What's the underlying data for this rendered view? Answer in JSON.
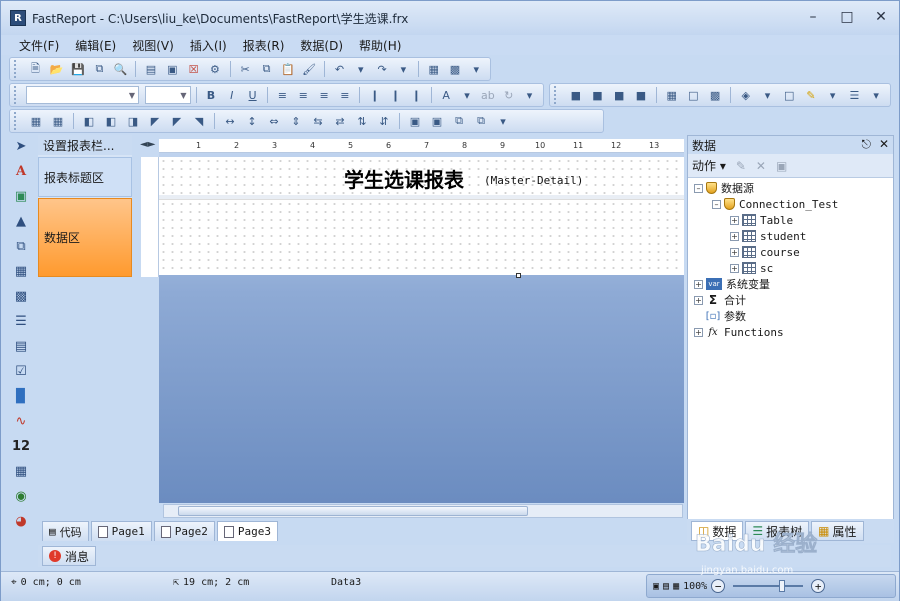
{
  "window": {
    "title": "FastReport - C:\\Users\\liu_ke\\Documents\\FastReport\\学生选课.frx",
    "icon_letter": "R"
  },
  "menu": [
    "文件(F)",
    "编辑(E)",
    "视图(V)",
    "插入(I)",
    "报表(R)",
    "数据(D)",
    "帮助(H)"
  ],
  "bands": {
    "header": "设置报表栏...",
    "title_band": "报表标题区",
    "data_band": "数据区"
  },
  "report": {
    "title": "学生选课报表",
    "subtitle": "(Master-Detail)"
  },
  "ruler_ticks": [
    "1",
    "2",
    "3",
    "4",
    "5",
    "6",
    "7",
    "8",
    "9",
    "10",
    "11",
    "12",
    "13"
  ],
  "page_tabs": [
    {
      "label": "代码"
    },
    {
      "label": "Page1"
    },
    {
      "label": "Page2"
    },
    {
      "label": "Page3"
    }
  ],
  "messages_tab": "消息",
  "status": {
    "position": "0 cm; 0 cm",
    "size": "19 cm; 2 cm",
    "object": "Data3",
    "zoom": "100%"
  },
  "data_panel": {
    "title": "数据",
    "actions_label": "动作",
    "tree": {
      "datasource": "数据源",
      "connection": "Connection_Test",
      "tables": [
        "Table",
        "student",
        "course",
        "sc"
      ],
      "sysvars": "系统变量",
      "totals": "合计",
      "params": "参数",
      "functions": "Functions"
    },
    "tabs": [
      "数据",
      "报表树",
      "属性"
    ]
  },
  "watermark": {
    "brand": "Baidu 经验",
    "url": "jingyan.baidu.com"
  },
  "colors": {
    "data_band": "#ff9a2e",
    "accent": "#3b6fb5"
  }
}
